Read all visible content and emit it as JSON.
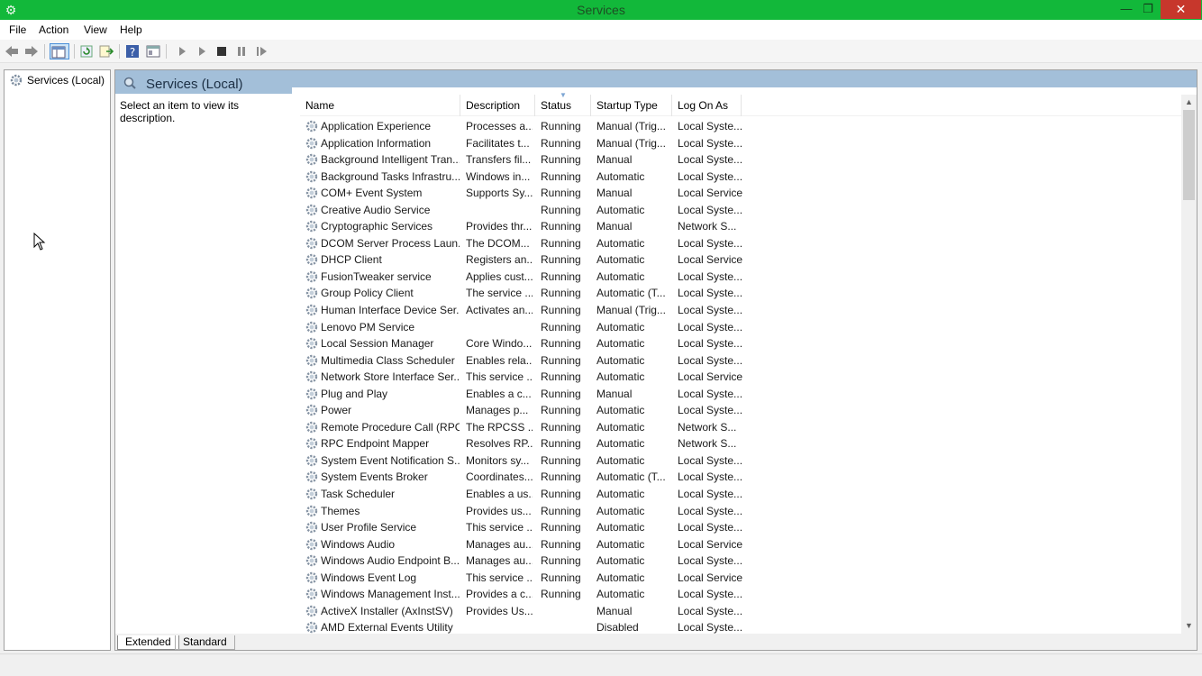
{
  "window": {
    "title": "Services"
  },
  "menu": [
    "File",
    "Action",
    "View",
    "Help"
  ],
  "tree": {
    "root": "Services (Local)"
  },
  "panel": {
    "title": "Services (Local)",
    "description": "Select an item to view its description."
  },
  "columns": {
    "name": "Name",
    "description": "Description",
    "status": "Status",
    "startup": "Startup Type",
    "logon": "Log On As"
  },
  "services": [
    [
      "Application Experience",
      "Processes a...",
      "Running",
      "Manual (Trig...",
      "Local Syste..."
    ],
    [
      "Application Information",
      "Facilitates t...",
      "Running",
      "Manual (Trig...",
      "Local Syste..."
    ],
    [
      "Background Intelligent Tran...",
      "Transfers fil...",
      "Running",
      "Manual",
      "Local Syste..."
    ],
    [
      "Background Tasks Infrastru...",
      "Windows in...",
      "Running",
      "Automatic",
      "Local Syste..."
    ],
    [
      "COM+ Event System",
      "Supports Sy...",
      "Running",
      "Manual",
      "Local Service"
    ],
    [
      "Creative Audio Service",
      "",
      "Running",
      "Automatic",
      "Local Syste..."
    ],
    [
      "Cryptographic Services",
      "Provides thr...",
      "Running",
      "Manual",
      "Network S..."
    ],
    [
      "DCOM Server Process Laun...",
      "The DCOM...",
      "Running",
      "Automatic",
      "Local Syste..."
    ],
    [
      "DHCP Client",
      "Registers an...",
      "Running",
      "Automatic",
      "Local Service"
    ],
    [
      "FusionTweaker service",
      "Applies cust...",
      "Running",
      "Automatic",
      "Local Syste..."
    ],
    [
      "Group Policy Client",
      "The service ...",
      "Running",
      "Automatic (T...",
      "Local Syste..."
    ],
    [
      "Human Interface Device Ser...",
      "Activates an...",
      "Running",
      "Manual (Trig...",
      "Local Syste..."
    ],
    [
      "Lenovo PM Service",
      "",
      "Running",
      "Automatic",
      "Local Syste..."
    ],
    [
      "Local Session Manager",
      "Core Windo...",
      "Running",
      "Automatic",
      "Local Syste..."
    ],
    [
      "Multimedia Class Scheduler",
      "Enables rela...",
      "Running",
      "Automatic",
      "Local Syste..."
    ],
    [
      "Network Store Interface Ser...",
      "This service ...",
      "Running",
      "Automatic",
      "Local Service"
    ],
    [
      "Plug and Play",
      "Enables a c...",
      "Running",
      "Manual",
      "Local Syste..."
    ],
    [
      "Power",
      "Manages p...",
      "Running",
      "Automatic",
      "Local Syste..."
    ],
    [
      "Remote Procedure Call (RPC)",
      "The RPCSS ...",
      "Running",
      "Automatic",
      "Network S..."
    ],
    [
      "RPC Endpoint Mapper",
      "Resolves RP...",
      "Running",
      "Automatic",
      "Network S..."
    ],
    [
      "System Event Notification S...",
      "Monitors sy...",
      "Running",
      "Automatic",
      "Local Syste..."
    ],
    [
      "System Events Broker",
      "Coordinates...",
      "Running",
      "Automatic (T...",
      "Local Syste..."
    ],
    [
      "Task Scheduler",
      "Enables a us...",
      "Running",
      "Automatic",
      "Local Syste..."
    ],
    [
      "Themes",
      "Provides us...",
      "Running",
      "Automatic",
      "Local Syste..."
    ],
    [
      "User Profile Service",
      "This service ...",
      "Running",
      "Automatic",
      "Local Syste..."
    ],
    [
      "Windows Audio",
      "Manages au...",
      "Running",
      "Automatic",
      "Local Service"
    ],
    [
      "Windows Audio Endpoint B...",
      "Manages au...",
      "Running",
      "Automatic",
      "Local Syste..."
    ],
    [
      "Windows Event Log",
      "This service ...",
      "Running",
      "Automatic",
      "Local Service"
    ],
    [
      "Windows Management Inst...",
      "Provides a c...",
      "Running",
      "Automatic",
      "Local Syste..."
    ],
    [
      "ActiveX Installer (AxInstSV)",
      "Provides Us...",
      "",
      "Manual",
      "Local Syste..."
    ],
    [
      "AMD External Events Utility",
      "",
      "",
      "Disabled",
      "Local Syste..."
    ]
  ],
  "tabs": [
    "Extended",
    "Standard"
  ],
  "colors": {
    "titlebar": "#12b83a",
    "close": "#c7372c",
    "header_band": "#a3bfd9"
  }
}
